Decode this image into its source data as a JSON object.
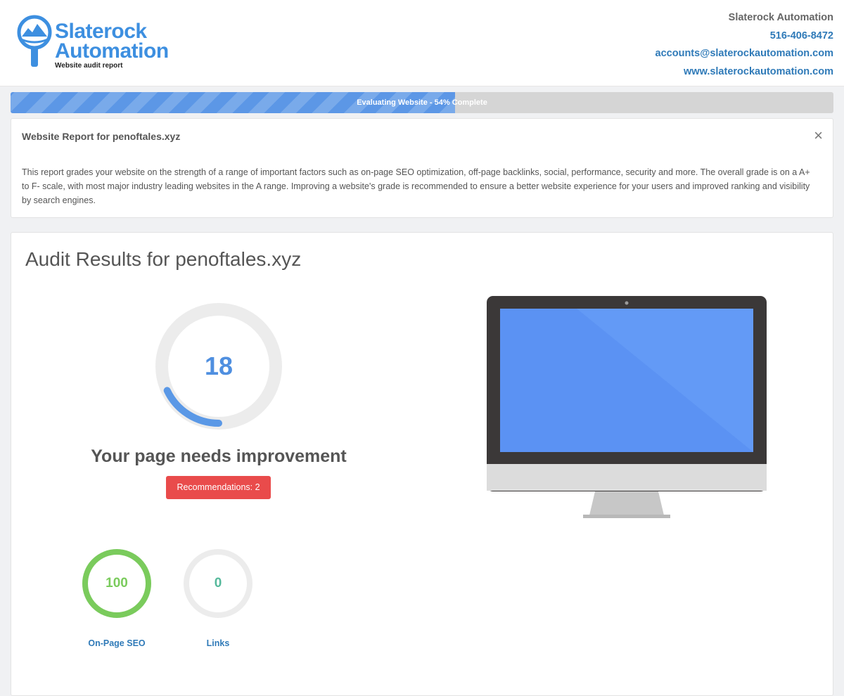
{
  "brand": {
    "logo_line1": "Slaterock",
    "logo_line2": "Automation",
    "logo_tagline": "Website audit report",
    "color": "#3d8fe0"
  },
  "company": {
    "name": "Slaterock Automation",
    "phone": "516-406-8472",
    "email": "accounts@slaterockautomation.com",
    "website": "www.slaterockautomation.com"
  },
  "progress": {
    "label": "Evaluating Website - 54% Complete",
    "percent": 54
  },
  "info": {
    "title": "Website Report for penoftales.xyz",
    "close_icon": "×",
    "text": "This report grades your website on the strength of a range of important factors such as on-page SEO optimization, off-page backlinks, social, performance, security and more. The overall grade is on a A+ to F- scale, with most major industry leading websites in the A range. Improving a website's grade is recommended to ensure a better website experience for your users and improved ranking and visibility by search engines."
  },
  "results": {
    "title": "Audit Results for penoftales.xyz",
    "score": "18",
    "score_fraction": 0.18,
    "score_color": "#5a98e6",
    "verdict": "Your page needs improvement",
    "recommendations_label": "Recommendations: 2",
    "metrics": [
      {
        "value": "100",
        "label": "On-Page SEO",
        "fraction": 1.0,
        "color": "#7acb5c"
      },
      {
        "value": "0",
        "label": "Links",
        "fraction": 0.0,
        "color": "#55b99b"
      }
    ]
  }
}
